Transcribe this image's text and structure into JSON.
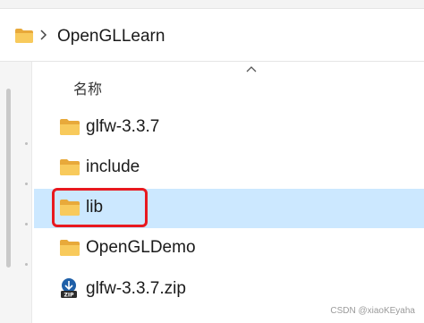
{
  "address_bar": {
    "path": "OpenGLLearn",
    "folder_icon": "folder-icon",
    "chevron_icon": "chevron-right-icon"
  },
  "file_list": {
    "column_header": "名称",
    "sort_icon": "sort-caret-up-icon",
    "items": [
      {
        "name": "glfw-3.3.7",
        "icon": "folder-icon",
        "selected": false
      },
      {
        "name": "include",
        "icon": "folder-icon",
        "selected": false
      },
      {
        "name": "lib",
        "icon": "folder-icon",
        "selected": true
      },
      {
        "name": "OpenGLDemo",
        "icon": "folder-icon",
        "selected": false
      },
      {
        "name": "glfw-3.3.7.zip",
        "icon": "zip-archive-icon",
        "selected": false
      }
    ]
  },
  "annotation": {
    "highlight_color": "#e8191f",
    "selection_color": "#cce8ff"
  },
  "watermark": "CSDN @xiaoKEyaha"
}
